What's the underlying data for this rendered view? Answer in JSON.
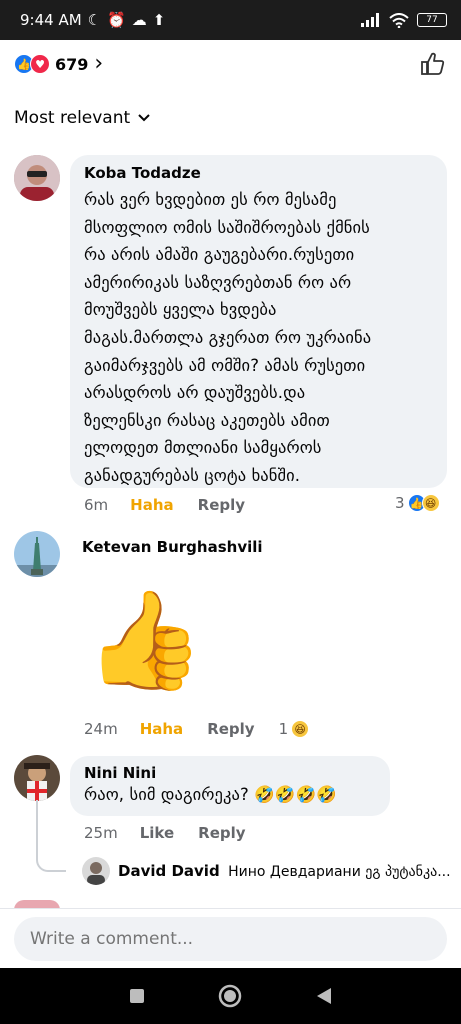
{
  "status_bar": {
    "time": "9:44 AM",
    "battery": "77"
  },
  "reactions": {
    "count": "679"
  },
  "sort": {
    "label": "Most relevant"
  },
  "comments": [
    {
      "author": "Koba Todadze",
      "text": "რას ვერ ხვდებით ეს რო მესამე\nმსოფლიო ომის საშიშროებას ქმნის\nრა არის ამაში გაუგებარი.რუსეთი\nამერირიკას საზღვრებთან რო არ\nმოუშვებს ყველა ხვდება\nმაგას.მართლა გჯერათ რო უკრაინა\nგაიმარჯვებს ამ ომში? ამას რუსეთი\nარასდროს არ დაუშვებს.და\nზელენსკი რასაც აკეთებს ამით\nელოდეთ მთლიანი სამყაროს\nგანადგურებას ცოტა ხანში.",
      "time": "6m",
      "reaction_label": "Haha",
      "reply_label": "Reply",
      "reaction_count": "3"
    },
    {
      "author": "Ketevan Burghashvili",
      "sticker": "👍",
      "time": "24m",
      "reaction_label": "Haha",
      "reply_label": "Reply",
      "reaction_count": "1"
    },
    {
      "author": "Nini Nini",
      "text": "რაო, სიმ დაგირეკა? 🤣🤣🤣🤣",
      "time": "25m",
      "like_label": "Like",
      "reply_label": "Reply"
    }
  ],
  "reply_preview": {
    "author": "David David",
    "text": "Нино Девдариани ეგ პუტანკა..."
  },
  "composer": {
    "placeholder": "Write a comment..."
  },
  "colors": {
    "accent_blue": "#1877f2",
    "haha_yellow": "#f0a400",
    "bubble_gray": "#eff2f5"
  }
}
